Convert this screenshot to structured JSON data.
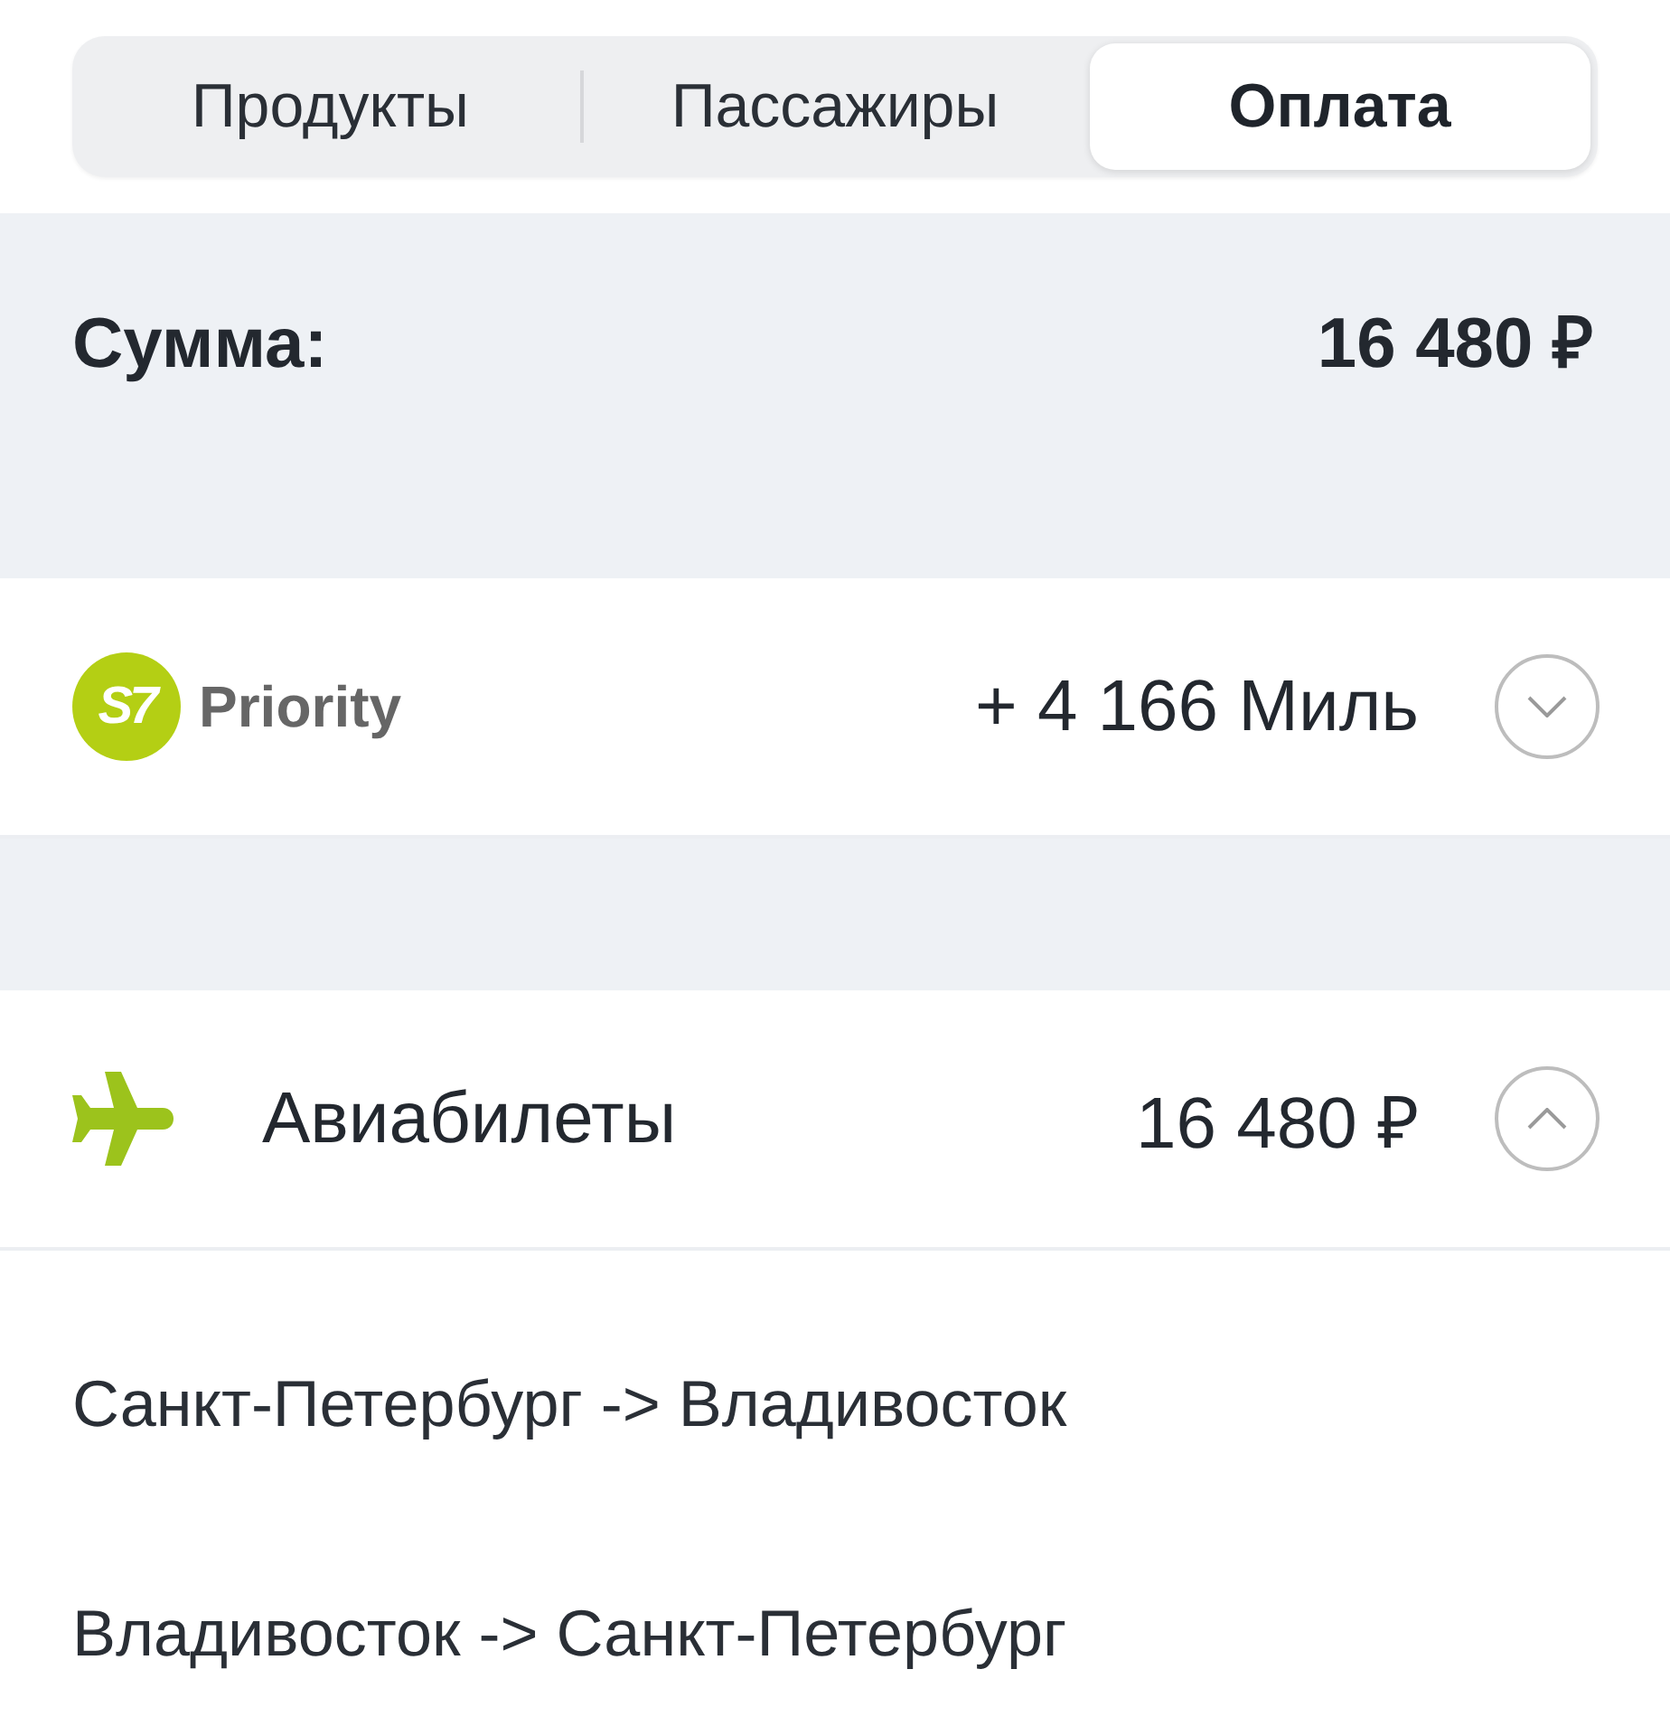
{
  "tabs": [
    {
      "label": "Продукты",
      "selected": false
    },
    {
      "label": "Пассажиры",
      "selected": false
    },
    {
      "label": "Оплата",
      "selected": true
    }
  ],
  "total": {
    "label": "Сумма:",
    "amount": "16 480 ₽"
  },
  "sections": [
    {
      "kind": "loyalty",
      "badge": "S7",
      "name": "Priority",
      "value": "+ 4 166 Миль",
      "expanded": false
    },
    {
      "kind": "tickets",
      "title": "Авиабилеты",
      "value": "16 480 ₽",
      "expanded": true,
      "routes": [
        "Санкт-Петербург -> Владивосток",
        "Владивосток -> Санкт-Петербург"
      ]
    }
  ]
}
